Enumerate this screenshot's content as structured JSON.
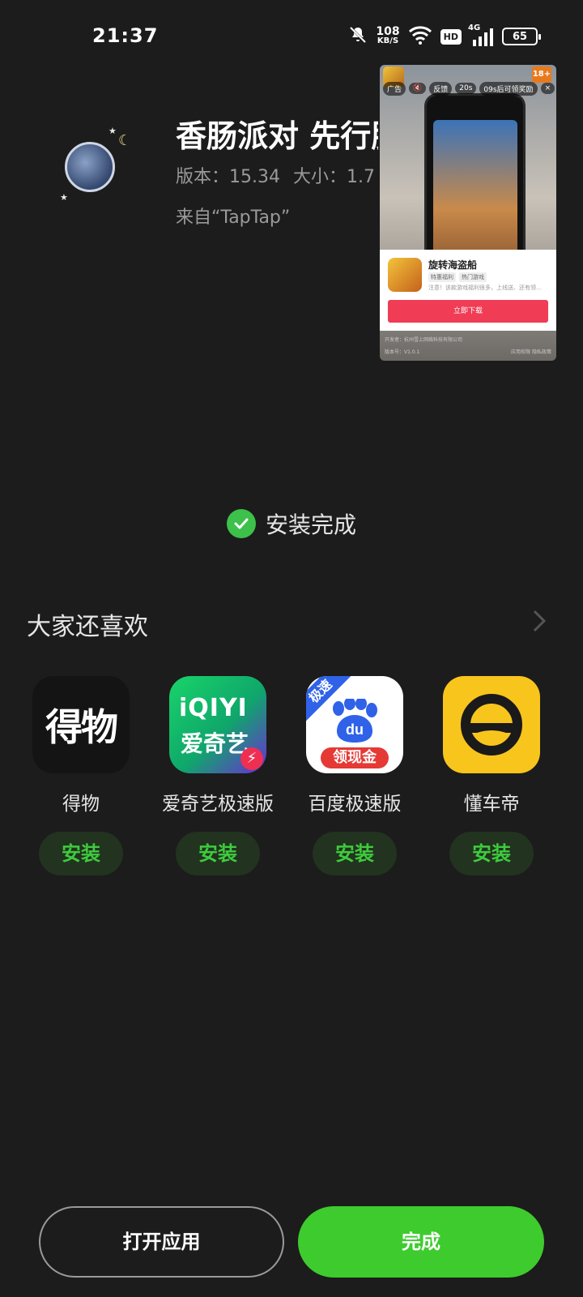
{
  "status_bar": {
    "time": "21:37",
    "net_speed_value": "108",
    "net_speed_unit": "KB/S",
    "network_type": "4G",
    "hd_label": "HD",
    "battery": "65"
  },
  "app": {
    "title": "香肠派对 先行服",
    "version": "版本：15.34",
    "size": "大小：1.7",
    "source": "来自“TapTap”"
  },
  "ad": {
    "label": "广告",
    "feedback": "反馈",
    "countdown": "20s",
    "reward_text": "09s后可领奖励",
    "close": "×",
    "age_rating": "18+",
    "game_title": "旋转海盗船",
    "tags": [
      "特惠福利",
      "热门游戏"
    ],
    "description": "注意！该款游戏福利很多，上线送、还有领…",
    "cta": "立即下载",
    "developer": "开发者：杭州雪上网络科技有限公司",
    "version": "版本号：V1.0.1",
    "privacy": "应用权限",
    "policy": "隐私政策"
  },
  "install": {
    "status": "安装完成"
  },
  "recommend": {
    "title": "大家还喜欢",
    "apps": [
      {
        "name": "得物",
        "icon_text": "得物",
        "button": "安装"
      },
      {
        "name": "爱奇艺极速版",
        "icon_text_1": "iQIYI",
        "icon_text_2": "爱奇艺",
        "button": "安装"
      },
      {
        "name": "百度极速版",
        "corner_text": "极速",
        "icon_text": "du",
        "ribbon_text": "领现金",
        "button": "安装"
      },
      {
        "name": "懂车帝",
        "button": "安装"
      }
    ]
  },
  "actions": {
    "open": "打开应用",
    "done": "完成"
  },
  "colors": {
    "background": "#1c1c1c",
    "accent_green": "#3ecb2e",
    "install_button_bg": "#22331f",
    "install_button_text": "#3ecb3e"
  }
}
